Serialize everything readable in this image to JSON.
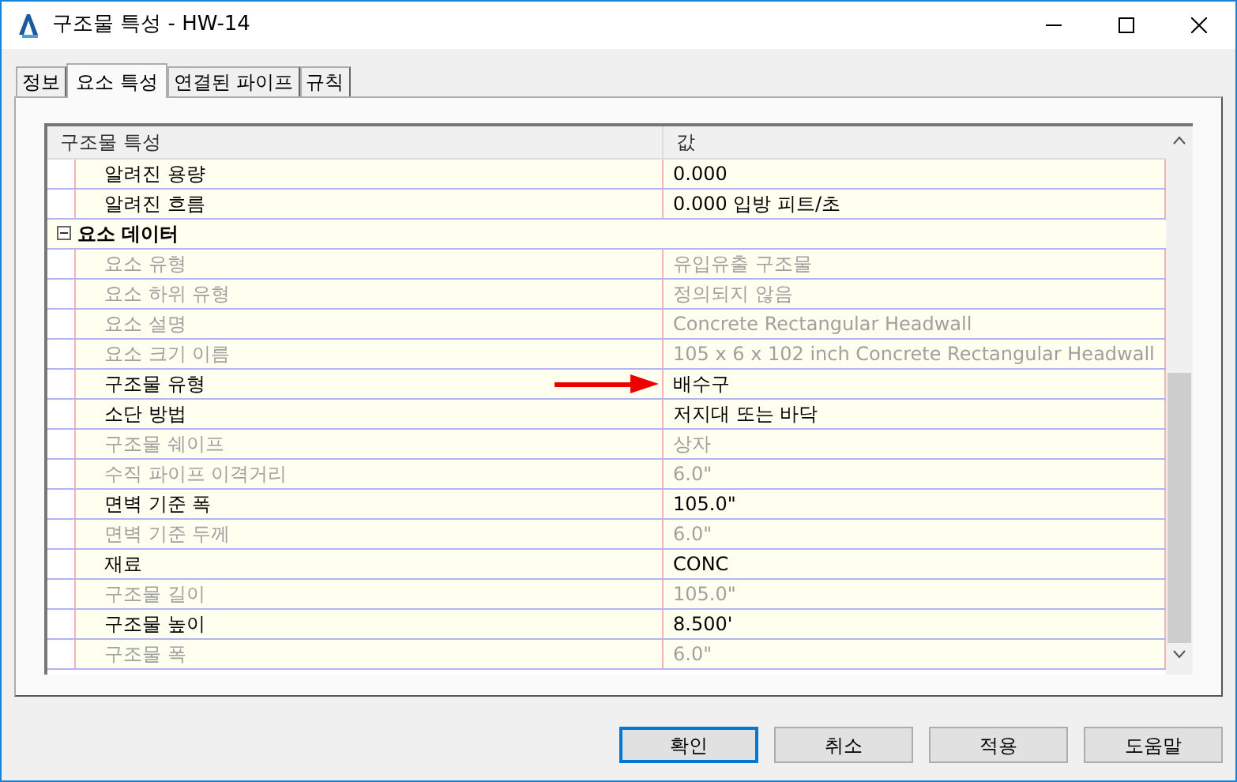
{
  "window": {
    "title": "구조물 특성 - HW-14"
  },
  "tabs": [
    {
      "label": "정보",
      "selected": false
    },
    {
      "label": "요소 특성",
      "selected": true
    },
    {
      "label": "연결된 파이프",
      "selected": false
    },
    {
      "label": "규칙",
      "selected": false
    }
  ],
  "table": {
    "columns": [
      "구조물 특성",
      "값"
    ],
    "rows": [
      {
        "kind": "property",
        "name": "알려진 용량",
        "value": "0.000",
        "disabled": false,
        "arrow": false
      },
      {
        "kind": "property",
        "name": "알려진 흐름",
        "value": "0.000 입방 피트/초",
        "disabled": false,
        "arrow": false
      },
      {
        "kind": "group",
        "name": "요소 데이터",
        "expanded": true
      },
      {
        "kind": "property",
        "name": "요소 유형",
        "value": "유입유출 구조물",
        "disabled": true,
        "arrow": false
      },
      {
        "kind": "property",
        "name": "요소 하위 유형",
        "value": "정의되지 않음",
        "disabled": true,
        "arrow": false
      },
      {
        "kind": "property",
        "name": "요소 설명",
        "value": "Concrete Rectangular Headwall",
        "disabled": true,
        "arrow": false
      },
      {
        "kind": "property",
        "name": "요소 크기 이름",
        "value": "105 x 6 x 102 inch Concrete Rectangular Headwall",
        "disabled": true,
        "arrow": false
      },
      {
        "kind": "property",
        "name": "구조물 유형",
        "value": "배수구",
        "disabled": false,
        "arrow": true
      },
      {
        "kind": "property",
        "name": "소단 방법",
        "value": "저지대 또는 바닥",
        "disabled": false,
        "arrow": false
      },
      {
        "kind": "property",
        "name": "구조물 쉐이프",
        "value": "상자",
        "disabled": true,
        "arrow": false
      },
      {
        "kind": "property",
        "name": "수직 파이프 이격거리",
        "value": "6.0\"",
        "disabled": true,
        "arrow": false
      },
      {
        "kind": "property",
        "name": "면벽 기준 폭",
        "value": "105.0\"",
        "disabled": false,
        "arrow": false
      },
      {
        "kind": "property",
        "name": "면벽 기준 두께",
        "value": "6.0\"",
        "disabled": true,
        "arrow": false
      },
      {
        "kind": "property",
        "name": "재료",
        "value": "CONC",
        "disabled": false,
        "arrow": false
      },
      {
        "kind": "property",
        "name": "구조물 길이",
        "value": "105.0\"",
        "disabled": true,
        "arrow": false
      },
      {
        "kind": "property",
        "name": "구조물 높이",
        "value": "8.500'",
        "disabled": false,
        "arrow": false
      },
      {
        "kind": "property",
        "name": "구조물 폭",
        "value": "6.0\"",
        "disabled": true,
        "arrow": false
      }
    ]
  },
  "buttons": [
    {
      "label": "확인",
      "selected": true
    },
    {
      "label": "취소",
      "selected": false
    },
    {
      "label": "적용",
      "selected": false
    },
    {
      "label": "도움말",
      "selected": false
    }
  ]
}
